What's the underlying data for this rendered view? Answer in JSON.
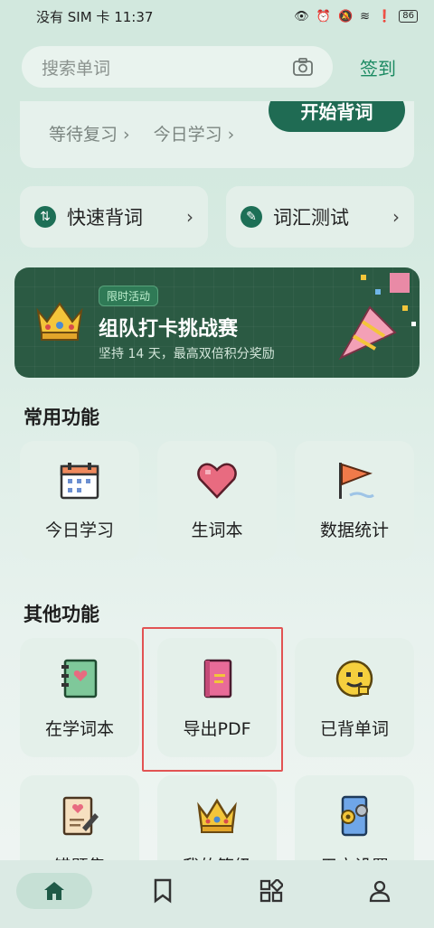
{
  "status_bar": {
    "carrier_time": "没有 SIM 卡 11:37",
    "battery": "86",
    "icons": [
      "eye-icon",
      "alarm-icon",
      "mute-icon",
      "wifi-icon",
      "alert-icon",
      "battery-icon"
    ]
  },
  "header": {
    "search_placeholder": "搜索单词",
    "camera_icon": "camera-icon",
    "signin_label": "签到"
  },
  "top_card": {
    "review_link": "等待复习 ›",
    "today_link": "今日学习 ›",
    "start_button": "开始背词"
  },
  "quick_actions": [
    {
      "label": "快速背词",
      "icon": "shuffle-icon"
    },
    {
      "label": "词汇测试",
      "icon": "wrench-icon"
    }
  ],
  "banner": {
    "tag": "限时活动",
    "title": "组队打卡挑战赛",
    "subtitle": "坚持 14 天，最高双倍积分奖励"
  },
  "common": {
    "title": "常用功能",
    "items": [
      {
        "label": "今日学习",
        "icon": "calendar-icon"
      },
      {
        "label": "生词本",
        "icon": "heart-icon"
      },
      {
        "label": "数据统计",
        "icon": "flag-icon"
      }
    ]
  },
  "other": {
    "title": "其他功能",
    "items": [
      {
        "label": "在学词本",
        "icon": "notebook-icon"
      },
      {
        "label": "导出PDF",
        "icon": "book-export-icon"
      },
      {
        "label": "已背单词",
        "icon": "smiley-icon"
      },
      {
        "label": "错题集",
        "icon": "document-pen-icon"
      },
      {
        "label": "我的等级",
        "icon": "crown-icon"
      },
      {
        "label": "用户设置",
        "icon": "gear-phone-icon"
      }
    ]
  },
  "bottom_nav": [
    {
      "name": "home",
      "icon": "home-icon",
      "active": true
    },
    {
      "name": "wordbook",
      "icon": "bookmark-icon",
      "active": false
    },
    {
      "name": "apps",
      "icon": "apps-icon",
      "active": false
    },
    {
      "name": "profile",
      "icon": "user-icon",
      "active": false
    }
  ],
  "colors": {
    "accent": "#1f6b53",
    "link": "#1c8a62",
    "highlight": "#e25353"
  }
}
